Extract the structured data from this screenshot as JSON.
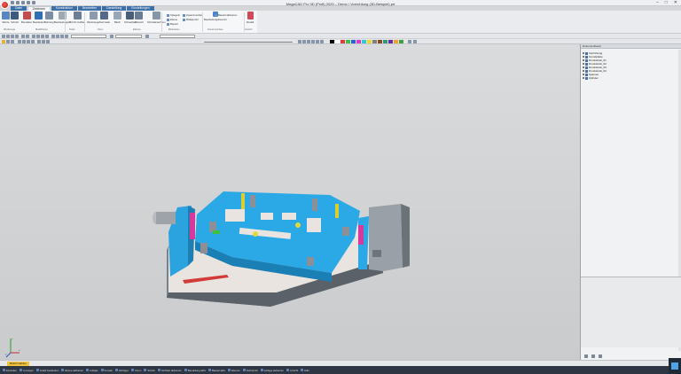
{
  "window": {
    "title": "MegaCAD Pro 3D (Profi) 2020 – Demo / Vorrichtung (3D-Beispiel).prt",
    "controls": {
      "minimize": "–",
      "maximize": "□",
      "close": "✕"
    }
  },
  "tabs": [
    "Datei",
    "Zeichnen",
    "Konstruktion",
    "Bearbeiten",
    "Darstellung",
    "Einstellungen"
  ],
  "active_tab": "Zeichnen",
  "ribbon": {
    "buttons": [
      "Skizze",
      "Schnitt",
      "Bemaßen",
      "Bearbeiten",
      "Bohrung",
      "Bearbeitungen",
      "3D-NC Aufbau",
      "Werkzeuge",
      "Normteile",
      "Blech",
      "Schweißen",
      "Flansch",
      "Schnittansichten"
    ],
    "small": [
      "Spiegeln",
      "Zusammenbau",
      "Ebene",
      "Mittelpunkt",
      "Bauteil",
      "Bearbeitungsbereich",
      "Bauteil aktivieren",
      "Modell"
    ],
    "groups": [
      "Werkzeuge",
      "Modifizieren",
      "Teilen",
      "Norm",
      "Ebenen",
      "Bearbeiten",
      "Zusammenbau",
      "Ansicht"
    ]
  },
  "tree": {
    "header": "Dokumentbaum",
    "items": [
      "Vorrichtung",
      "Grundplatte",
      "Druckstück_01",
      "Druckstück_02",
      "Druckstück_03",
      "Druckstück_04",
      "Spanner",
      "Zylinder"
    ]
  },
  "command": {
    "label": "Befehl wählen"
  },
  "statusbar": [
    "Einstellen",
    "Anzeigen",
    "Grafik bearbeiten",
    "Ebene aktivieren",
    "Auflage",
    "Fenster",
    "Einfügen",
    "Zoom",
    "Schnitt",
    "Sichtbar aktivieren",
    "Bemaßung aktiv",
    "Bauteil aktiv",
    "Ebenen",
    "Drehpunkt",
    "Auflage aktivieren",
    "Ansicht",
    "Hilfe"
  ],
  "axis": {
    "x": "x",
    "y": "y",
    "z": "z"
  },
  "colors": {
    "accent": "#3d6fa8",
    "model_blue": "#2aa9e6",
    "model_gray": "#9aa0a7",
    "status_bg": "#2d3642"
  }
}
